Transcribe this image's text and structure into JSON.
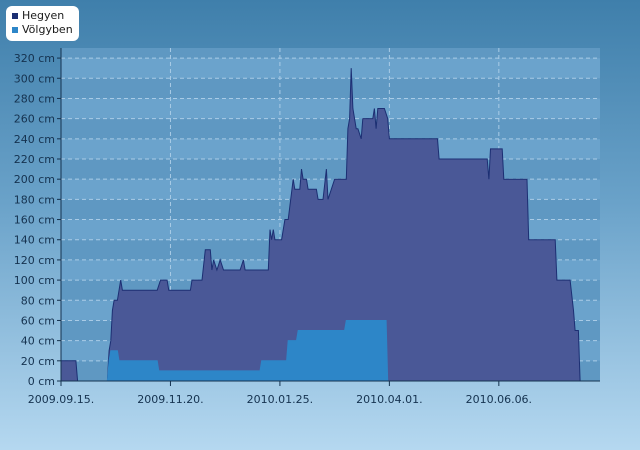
{
  "chart_data": {
    "type": "area",
    "title": "",
    "xlabel": "",
    "ylabel": "",
    "y_unit": "cm",
    "ylim": [
      0,
      330
    ],
    "yticks": [
      0,
      20,
      40,
      60,
      80,
      100,
      120,
      140,
      160,
      180,
      200,
      220,
      240,
      260,
      280,
      300,
      320
    ],
    "xlim": [
      "2009.09.15.",
      "2010.08.06."
    ],
    "xticks": [
      "2009.09.15.",
      "2009.11.20.",
      "2010.01.25.",
      "2010.04.01.",
      "2010.06.06."
    ],
    "grid": true,
    "legend_position": "top-left",
    "series": [
      {
        "name": "Hegyen",
        "color": "#1c2f73",
        "fill": "#4a5897",
        "points": [
          [
            "2009.09.15.",
            20
          ],
          [
            "2009.09.24.",
            20
          ],
          [
            "2009.09.25.",
            0
          ],
          [
            "2009.10.13.",
            0
          ],
          [
            "2009.10.14.",
            30
          ],
          [
            "2009.10.15.",
            40
          ],
          [
            "2009.10.16.",
            70
          ],
          [
            "2009.10.17.",
            80
          ],
          [
            "2009.10.19.",
            80
          ],
          [
            "2009.10.21.",
            100
          ],
          [
            "2009.10.22.",
            90
          ],
          [
            "2009.11.12.",
            90
          ],
          [
            "2009.11.14.",
            100
          ],
          [
            "2009.11.18.",
            100
          ],
          [
            "2009.11.19.",
            90
          ],
          [
            "2009.12.02.",
            90
          ],
          [
            "2009.12.03.",
            100
          ],
          [
            "2009.12.09.",
            100
          ],
          [
            "2009.12.11.",
            130
          ],
          [
            "2009.12.14.",
            130
          ],
          [
            "2009.12.15.",
            110
          ],
          [
            "2009.12.16.",
            120
          ],
          [
            "2009.12.18.",
            110
          ],
          [
            "2009.12.20.",
            120
          ],
          [
            "2009.12.22.",
            110
          ],
          [
            "2010.01.01.",
            110
          ],
          [
            "2010.01.03.",
            120
          ],
          [
            "2010.01.04.",
            110
          ],
          [
            "2010.01.18.",
            110
          ],
          [
            "2010.01.19.",
            150
          ],
          [
            "2010.01.20.",
            140
          ],
          [
            "2010.01.21.",
            150
          ],
          [
            "2010.01.22.",
            140
          ],
          [
            "2010.01.26.",
            140
          ],
          [
            "2010.01.28.",
            160
          ],
          [
            "2010.01.30.",
            160
          ],
          [
            "2010.02.02.",
            200
          ],
          [
            "2010.02.03.",
            190
          ],
          [
            "2010.02.06.",
            190
          ],
          [
            "2010.02.07.",
            210
          ],
          [
            "2010.02.08.",
            200
          ],
          [
            "2010.02.10.",
            200
          ],
          [
            "2010.02.11.",
            190
          ],
          [
            "2010.02.16.",
            190
          ],
          [
            "2010.02.17.",
            180
          ],
          [
            "2010.02.20.",
            180
          ],
          [
            "2010.02.22.",
            210
          ],
          [
            "2010.02.23.",
            180
          ],
          [
            "2010.02.25.",
            190
          ],
          [
            "2010.02.27.",
            200
          ],
          [
            "2010.03.06.",
            200
          ],
          [
            "2010.03.07.",
            250
          ],
          [
            "2010.03.08.",
            260
          ],
          [
            "2010.03.09.",
            310
          ],
          [
            "2010.03.10.",
            270
          ],
          [
            "2010.03.12.",
            250
          ],
          [
            "2010.03.13.",
            250
          ],
          [
            "2010.03.15.",
            240
          ],
          [
            "2010.03.16.",
            260
          ],
          [
            "2010.03.22.",
            260
          ],
          [
            "2010.03.23.",
            270
          ],
          [
            "2010.03.24.",
            250
          ],
          [
            "2010.03.25.",
            270
          ],
          [
            "2010.03.29.",
            270
          ],
          [
            "2010.03.31.",
            260
          ],
          [
            "2010.04.01.",
            240
          ],
          [
            "2010.04.30.",
            240
          ],
          [
            "2010.05.01.",
            220
          ],
          [
            "2010.05.30.",
            220
          ],
          [
            "2010.05.31.",
            200
          ],
          [
            "2010.06.01.",
            230
          ],
          [
            "2010.06.08.",
            230
          ],
          [
            "2010.06.09.",
            200
          ],
          [
            "2010.06.23.",
            200
          ],
          [
            "2010.06.24.",
            140
          ],
          [
            "2010.07.10.",
            140
          ],
          [
            "2010.07.11.",
            100
          ],
          [
            "2010.07.19.",
            100
          ],
          [
            "2010.07.21.",
            70
          ],
          [
            "2010.07.22.",
            50
          ],
          [
            "2010.07.24.",
            50
          ],
          [
            "2010.07.25.",
            0
          ]
        ]
      },
      {
        "name": "Völgyben",
        "color": "#2d86c8",
        "fill": "#2d86c8",
        "points": [
          [
            "2009.09.15.",
            0
          ],
          [
            "2009.10.13.",
            0
          ],
          [
            "2009.10.14.",
            20
          ],
          [
            "2009.10.15.",
            30
          ],
          [
            "2009.10.19.",
            30
          ],
          [
            "2009.10.20.",
            20
          ],
          [
            "2009.11.12.",
            20
          ],
          [
            "2009.11.13.",
            10
          ],
          [
            "2010.01.13.",
            10
          ],
          [
            "2010.01.14.",
            20
          ],
          [
            "2010.01.29.",
            20
          ],
          [
            "2010.01.30.",
            40
          ],
          [
            "2010.02.04.",
            40
          ],
          [
            "2010.02.05.",
            50
          ],
          [
            "2010.03.05.",
            50
          ],
          [
            "2010.03.06.",
            60
          ],
          [
            "2010.03.30.",
            60
          ],
          [
            "2010.03.31.",
            0
          ]
        ]
      }
    ]
  }
}
